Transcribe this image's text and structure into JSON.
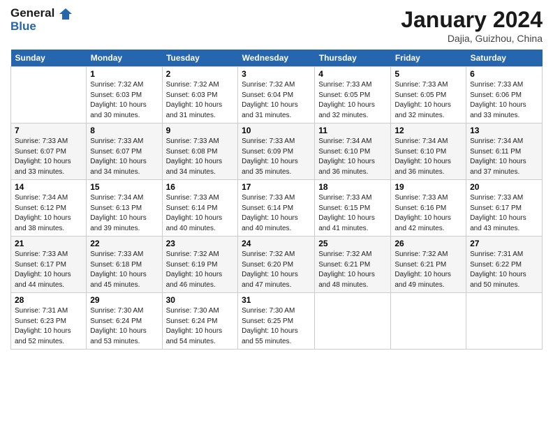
{
  "header": {
    "logo_line1": "General",
    "logo_line2": "Blue",
    "month": "January 2024",
    "location": "Dajia, Guizhou, China"
  },
  "days_of_week": [
    "Sunday",
    "Monday",
    "Tuesday",
    "Wednesday",
    "Thursday",
    "Friday",
    "Saturday"
  ],
  "weeks": [
    [
      {
        "day": "",
        "sunrise": "",
        "sunset": "",
        "daylight": ""
      },
      {
        "day": "1",
        "sunrise": "Sunrise: 7:32 AM",
        "sunset": "Sunset: 6:03 PM",
        "daylight": "Daylight: 10 hours and 30 minutes."
      },
      {
        "day": "2",
        "sunrise": "Sunrise: 7:32 AM",
        "sunset": "Sunset: 6:03 PM",
        "daylight": "Daylight: 10 hours and 31 minutes."
      },
      {
        "day": "3",
        "sunrise": "Sunrise: 7:32 AM",
        "sunset": "Sunset: 6:04 PM",
        "daylight": "Daylight: 10 hours and 31 minutes."
      },
      {
        "day": "4",
        "sunrise": "Sunrise: 7:33 AM",
        "sunset": "Sunset: 6:05 PM",
        "daylight": "Daylight: 10 hours and 32 minutes."
      },
      {
        "day": "5",
        "sunrise": "Sunrise: 7:33 AM",
        "sunset": "Sunset: 6:05 PM",
        "daylight": "Daylight: 10 hours and 32 minutes."
      },
      {
        "day": "6",
        "sunrise": "Sunrise: 7:33 AM",
        "sunset": "Sunset: 6:06 PM",
        "daylight": "Daylight: 10 hours and 33 minutes."
      }
    ],
    [
      {
        "day": "7",
        "sunrise": "Sunrise: 7:33 AM",
        "sunset": "Sunset: 6:07 PM",
        "daylight": "Daylight: 10 hours and 33 minutes."
      },
      {
        "day": "8",
        "sunrise": "Sunrise: 7:33 AM",
        "sunset": "Sunset: 6:07 PM",
        "daylight": "Daylight: 10 hours and 34 minutes."
      },
      {
        "day": "9",
        "sunrise": "Sunrise: 7:33 AM",
        "sunset": "Sunset: 6:08 PM",
        "daylight": "Daylight: 10 hours and 34 minutes."
      },
      {
        "day": "10",
        "sunrise": "Sunrise: 7:33 AM",
        "sunset": "Sunset: 6:09 PM",
        "daylight": "Daylight: 10 hours and 35 minutes."
      },
      {
        "day": "11",
        "sunrise": "Sunrise: 7:34 AM",
        "sunset": "Sunset: 6:10 PM",
        "daylight": "Daylight: 10 hours and 36 minutes."
      },
      {
        "day": "12",
        "sunrise": "Sunrise: 7:34 AM",
        "sunset": "Sunset: 6:10 PM",
        "daylight": "Daylight: 10 hours and 36 minutes."
      },
      {
        "day": "13",
        "sunrise": "Sunrise: 7:34 AM",
        "sunset": "Sunset: 6:11 PM",
        "daylight": "Daylight: 10 hours and 37 minutes."
      }
    ],
    [
      {
        "day": "14",
        "sunrise": "Sunrise: 7:34 AM",
        "sunset": "Sunset: 6:12 PM",
        "daylight": "Daylight: 10 hours and 38 minutes."
      },
      {
        "day": "15",
        "sunrise": "Sunrise: 7:34 AM",
        "sunset": "Sunset: 6:13 PM",
        "daylight": "Daylight: 10 hours and 39 minutes."
      },
      {
        "day": "16",
        "sunrise": "Sunrise: 7:33 AM",
        "sunset": "Sunset: 6:14 PM",
        "daylight": "Daylight: 10 hours and 40 minutes."
      },
      {
        "day": "17",
        "sunrise": "Sunrise: 7:33 AM",
        "sunset": "Sunset: 6:14 PM",
        "daylight": "Daylight: 10 hours and 40 minutes."
      },
      {
        "day": "18",
        "sunrise": "Sunrise: 7:33 AM",
        "sunset": "Sunset: 6:15 PM",
        "daylight": "Daylight: 10 hours and 41 minutes."
      },
      {
        "day": "19",
        "sunrise": "Sunrise: 7:33 AM",
        "sunset": "Sunset: 6:16 PM",
        "daylight": "Daylight: 10 hours and 42 minutes."
      },
      {
        "day": "20",
        "sunrise": "Sunrise: 7:33 AM",
        "sunset": "Sunset: 6:17 PM",
        "daylight": "Daylight: 10 hours and 43 minutes."
      }
    ],
    [
      {
        "day": "21",
        "sunrise": "Sunrise: 7:33 AM",
        "sunset": "Sunset: 6:17 PM",
        "daylight": "Daylight: 10 hours and 44 minutes."
      },
      {
        "day": "22",
        "sunrise": "Sunrise: 7:33 AM",
        "sunset": "Sunset: 6:18 PM",
        "daylight": "Daylight: 10 hours and 45 minutes."
      },
      {
        "day": "23",
        "sunrise": "Sunrise: 7:32 AM",
        "sunset": "Sunset: 6:19 PM",
        "daylight": "Daylight: 10 hours and 46 minutes."
      },
      {
        "day": "24",
        "sunrise": "Sunrise: 7:32 AM",
        "sunset": "Sunset: 6:20 PM",
        "daylight": "Daylight: 10 hours and 47 minutes."
      },
      {
        "day": "25",
        "sunrise": "Sunrise: 7:32 AM",
        "sunset": "Sunset: 6:21 PM",
        "daylight": "Daylight: 10 hours and 48 minutes."
      },
      {
        "day": "26",
        "sunrise": "Sunrise: 7:32 AM",
        "sunset": "Sunset: 6:21 PM",
        "daylight": "Daylight: 10 hours and 49 minutes."
      },
      {
        "day": "27",
        "sunrise": "Sunrise: 7:31 AM",
        "sunset": "Sunset: 6:22 PM",
        "daylight": "Daylight: 10 hours and 50 minutes."
      }
    ],
    [
      {
        "day": "28",
        "sunrise": "Sunrise: 7:31 AM",
        "sunset": "Sunset: 6:23 PM",
        "daylight": "Daylight: 10 hours and 52 minutes."
      },
      {
        "day": "29",
        "sunrise": "Sunrise: 7:30 AM",
        "sunset": "Sunset: 6:24 PM",
        "daylight": "Daylight: 10 hours and 53 minutes."
      },
      {
        "day": "30",
        "sunrise": "Sunrise: 7:30 AM",
        "sunset": "Sunset: 6:24 PM",
        "daylight": "Daylight: 10 hours and 54 minutes."
      },
      {
        "day": "31",
        "sunrise": "Sunrise: 7:30 AM",
        "sunset": "Sunset: 6:25 PM",
        "daylight": "Daylight: 10 hours and 55 minutes."
      },
      {
        "day": "",
        "sunrise": "",
        "sunset": "",
        "daylight": ""
      },
      {
        "day": "",
        "sunrise": "",
        "sunset": "",
        "daylight": ""
      },
      {
        "day": "",
        "sunrise": "",
        "sunset": "",
        "daylight": ""
      }
    ]
  ]
}
